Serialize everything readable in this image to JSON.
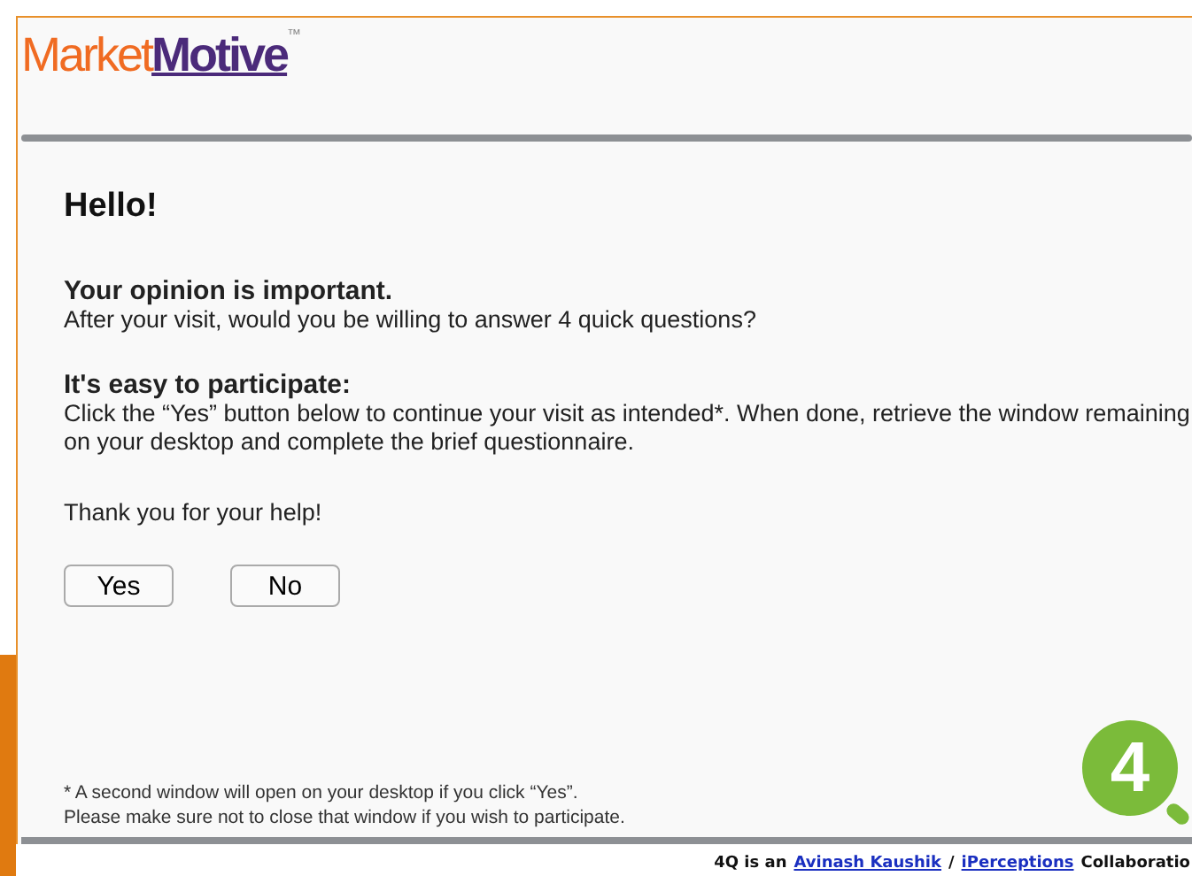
{
  "logo": {
    "part_1": "Market",
    "part_2": "Motive",
    "mark": "™"
  },
  "heading": "Hello!",
  "sections": [
    {
      "title": "Your opinion is important.",
      "text": "After your visit, would you be willing to answer 4 quick questions?"
    },
    {
      "title": "It's easy to participate:",
      "text": "Click the “Yes” button below to continue your visit as intended*. When done, retrieve the window remaining on your desktop and complete the brief questionnaire."
    }
  ],
  "thanks": "Thank you for your help!",
  "buttons": [
    "Yes",
    "No"
  ],
  "footnotes": [
    "* A second window will open on your desktop if you click “Yes”.",
    "Please make sure not to close that window if you wish to participate."
  ],
  "badge": "4",
  "credit": {
    "prefix": "4Q is an",
    "links": [
      "Avinash Kaushik",
      "iPerceptions"
    ],
    "separator": "/",
    "suffix": "Collaboratio"
  }
}
